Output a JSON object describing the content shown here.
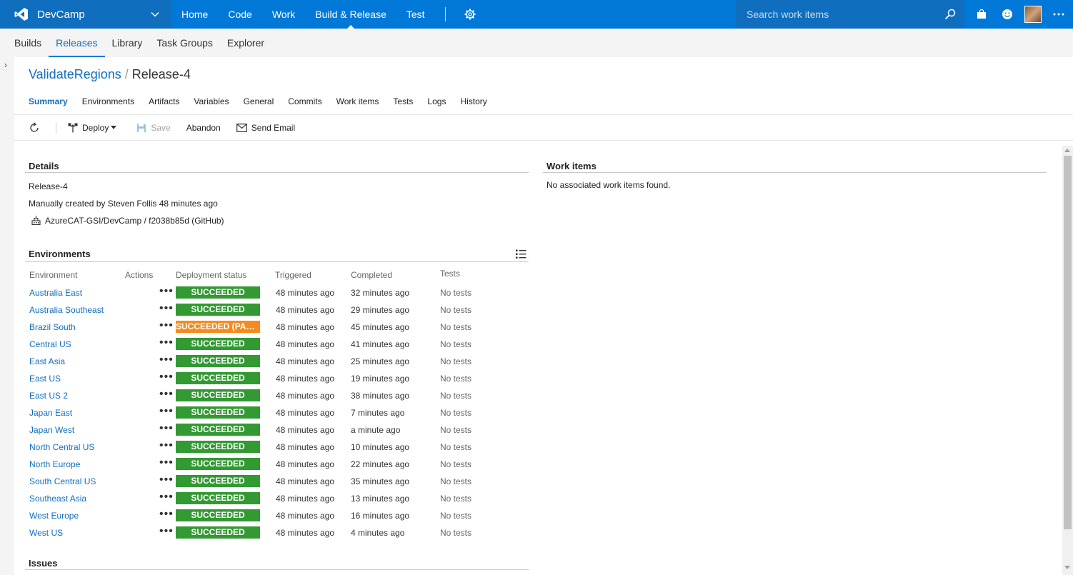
{
  "topbar": {
    "project": "DevCamp",
    "nav": [
      "Home",
      "Code",
      "Work",
      "Build & Release",
      "Test"
    ],
    "active_nav": "Build & Release",
    "search_placeholder": "Search work items",
    "brand_color": "#0078d7"
  },
  "subnav": {
    "items": [
      "Builds",
      "Releases",
      "Library",
      "Task Groups",
      "Explorer"
    ],
    "active": "Releases"
  },
  "breadcrumb": {
    "definition": "ValidateRegions",
    "separator": "/",
    "release": "Release-4"
  },
  "tabs": [
    "Summary",
    "Environments",
    "Artifacts",
    "Variables",
    "General",
    "Commits",
    "Work items",
    "Tests",
    "Logs",
    "History"
  ],
  "toolbar": {
    "deploy": "Deploy",
    "save": "Save",
    "abandon": "Abandon",
    "send_email": "Send Email"
  },
  "details": {
    "title": "Details",
    "release_name": "Release-4",
    "created": "Manually created by Steven Follis 48 minutes ago",
    "artifact": "AzureCAT-GSI/DevCamp / f2038b85d (GitHub)"
  },
  "work_items": {
    "title": "Work items",
    "empty": "No associated work items found."
  },
  "environments": {
    "title": "Environments",
    "columns": {
      "environment": "Environment",
      "actions": "Actions",
      "status": "Deployment status",
      "triggered": "Triggered",
      "completed": "Completed",
      "tests": "Tests"
    },
    "status_colors": {
      "success": "#339933",
      "partial": "#f58b1f"
    },
    "rows": [
      {
        "name": "Australia East",
        "status": "SUCCEEDED",
        "kind": "success",
        "triggered": "48 minutes ago",
        "completed": "32 minutes ago",
        "tests": "No tests"
      },
      {
        "name": "Australia Southeast",
        "status": "SUCCEEDED",
        "kind": "success",
        "triggered": "48 minutes ago",
        "completed": "29 minutes ago",
        "tests": "No tests"
      },
      {
        "name": "Brazil South",
        "status": "SUCCEEDED (PARTIALLY)",
        "kind": "partial",
        "triggered": "48 minutes ago",
        "completed": "45 minutes ago",
        "tests": "No tests"
      },
      {
        "name": "Central US",
        "status": "SUCCEEDED",
        "kind": "success",
        "triggered": "48 minutes ago",
        "completed": "41 minutes ago",
        "tests": "No tests"
      },
      {
        "name": "East Asia",
        "status": "SUCCEEDED",
        "kind": "success",
        "triggered": "48 minutes ago",
        "completed": "25 minutes ago",
        "tests": "No tests"
      },
      {
        "name": "East US",
        "status": "SUCCEEDED",
        "kind": "success",
        "triggered": "48 minutes ago",
        "completed": "19 minutes ago",
        "tests": "No tests"
      },
      {
        "name": "East US 2",
        "status": "SUCCEEDED",
        "kind": "success",
        "triggered": "48 minutes ago",
        "completed": "38 minutes ago",
        "tests": "No tests"
      },
      {
        "name": "Japan East",
        "status": "SUCCEEDED",
        "kind": "success",
        "triggered": "48 minutes ago",
        "completed": "7 minutes ago",
        "tests": "No tests"
      },
      {
        "name": "Japan West",
        "status": "SUCCEEDED",
        "kind": "success",
        "triggered": "48 minutes ago",
        "completed": "a minute ago",
        "tests": "No tests"
      },
      {
        "name": "North Central US",
        "status": "SUCCEEDED",
        "kind": "success",
        "triggered": "48 minutes ago",
        "completed": "10 minutes ago",
        "tests": "No tests"
      },
      {
        "name": "North Europe",
        "status": "SUCCEEDED",
        "kind": "success",
        "triggered": "48 minutes ago",
        "completed": "22 minutes ago",
        "tests": "No tests"
      },
      {
        "name": "South Central US",
        "status": "SUCCEEDED",
        "kind": "success",
        "triggered": "48 minutes ago",
        "completed": "35 minutes ago",
        "tests": "No tests"
      },
      {
        "name": "Southeast Asia",
        "status": "SUCCEEDED",
        "kind": "success",
        "triggered": "48 minutes ago",
        "completed": "13 minutes ago",
        "tests": "No tests"
      },
      {
        "name": "West Europe",
        "status": "SUCCEEDED",
        "kind": "success",
        "triggered": "48 minutes ago",
        "completed": "16 minutes ago",
        "tests": "No tests"
      },
      {
        "name": "West US",
        "status": "SUCCEEDED",
        "kind": "success",
        "triggered": "48 minutes ago",
        "completed": "4 minutes ago",
        "tests": "No tests"
      }
    ]
  },
  "issues": {
    "title": "Issues"
  }
}
